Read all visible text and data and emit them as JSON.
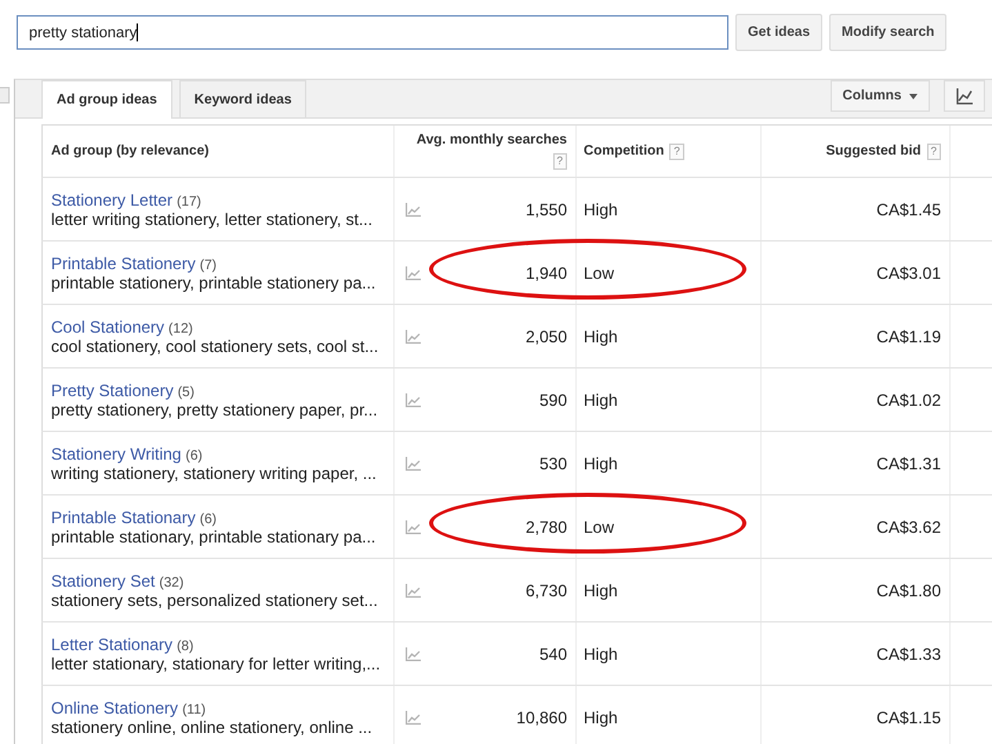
{
  "search": {
    "value": "pretty stationary"
  },
  "buttons": [
    "Get ideas",
    "Modify search"
  ],
  "tabs": [
    {
      "label": "Ad group ideas",
      "selected": true
    },
    {
      "label": "Keyword ideas",
      "selected": false
    }
  ],
  "columns_button": "Columns",
  "table": {
    "columns": [
      {
        "label": "Ad group (by relevance)"
      },
      {
        "label": "Avg. monthly searches",
        "help": "?"
      },
      {
        "label": "Competition",
        "help": "?"
      },
      {
        "label": "Suggested bid",
        "help": "?"
      }
    ],
    "rows": [
      {
        "name": "Stationery Letter",
        "count": "(17)",
        "keywords": "letter writing stationery, letter stationery, st...",
        "searches": "1,550",
        "competition": "High",
        "bid": "CA$1.45",
        "highlighted": false
      },
      {
        "name": "Printable Stationery",
        "count": "(7)",
        "keywords": "printable stationery, printable stationery pa...",
        "searches": "1,940",
        "competition": "Low",
        "bid": "CA$3.01",
        "highlighted": true
      },
      {
        "name": "Cool Stationery",
        "count": "(12)",
        "keywords": "cool stationery, cool stationery sets, cool st...",
        "searches": "2,050",
        "competition": "High",
        "bid": "CA$1.19",
        "highlighted": false
      },
      {
        "name": "Pretty Stationery",
        "count": "(5)",
        "keywords": "pretty stationery, pretty stationery paper, pr...",
        "searches": "590",
        "competition": "High",
        "bid": "CA$1.02",
        "highlighted": false
      },
      {
        "name": "Stationery Writing",
        "count": "(6)",
        "keywords": "writing stationery, stationery writing paper, ...",
        "searches": "530",
        "competition": "High",
        "bid": "CA$1.31",
        "highlighted": false
      },
      {
        "name": "Printable Stationary",
        "count": "(6)",
        "keywords": "printable stationary, printable stationary pa...",
        "searches": "2,780",
        "competition": "Low",
        "bid": "CA$3.62",
        "highlighted": true
      },
      {
        "name": "Stationery Set",
        "count": "(32)",
        "keywords": "stationery sets, personalized stationery set...",
        "searches": "6,730",
        "competition": "High",
        "bid": "CA$1.80",
        "highlighted": false
      },
      {
        "name": "Letter Stationary",
        "count": "(8)",
        "keywords": "letter stationary, stationary for letter writing,...",
        "searches": "540",
        "competition": "High",
        "bid": "CA$1.33",
        "highlighted": false
      },
      {
        "name": "Online Stationery",
        "count": "(11)",
        "keywords": "stationery online, online stationery, online ...",
        "searches": "10,860",
        "competition": "High",
        "bid": "CA$1.15",
        "highlighted": false
      }
    ]
  }
}
